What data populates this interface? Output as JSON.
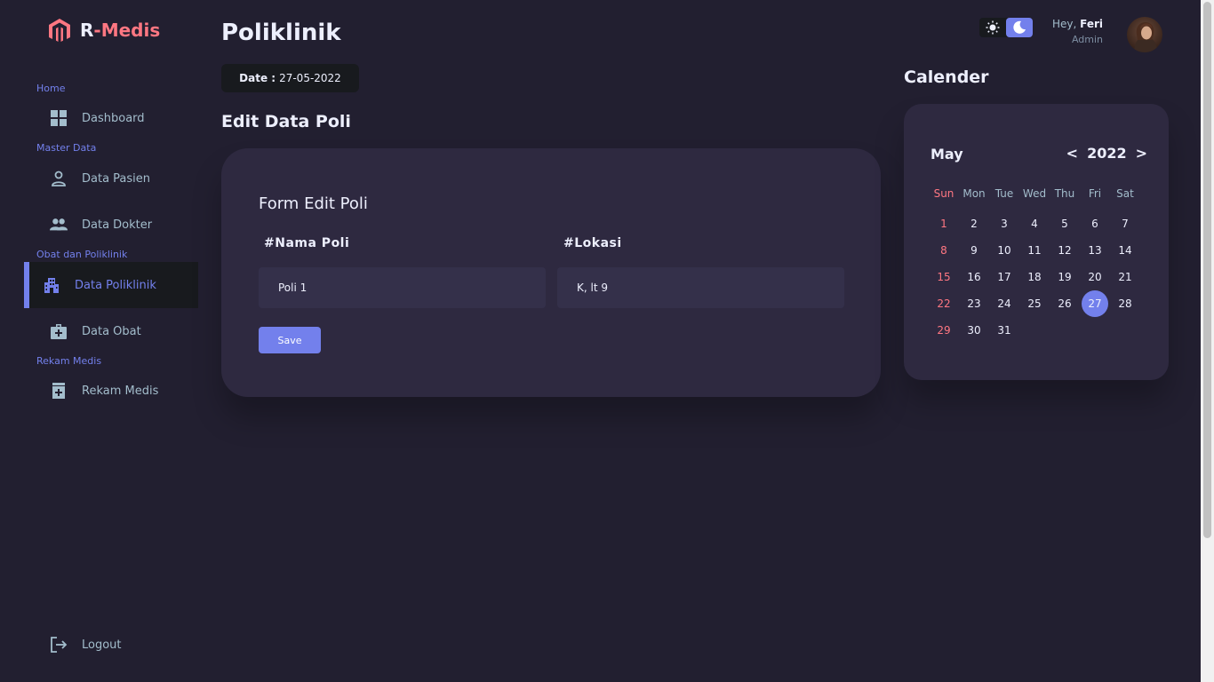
{
  "brand": {
    "prefix": "R",
    "suffix": "-Medis"
  },
  "sidebar": {
    "sections": {
      "home": "Home",
      "master": "Master Data",
      "obat_poli": "Obat dan Poliklinik",
      "rekam": "Rekam Medis"
    },
    "items": {
      "dashboard": {
        "label": "Dashboard",
        "icon": "dashboard-icon"
      },
      "pasien": {
        "label": "Data Pasien",
        "icon": "person-icon"
      },
      "dokter": {
        "label": "Data Dokter",
        "icon": "people-icon"
      },
      "poliklinik": {
        "label": "Data Poliklinik",
        "icon": "building-icon"
      },
      "obat": {
        "label": "Data Obat",
        "icon": "medical-kit-icon"
      },
      "rekam": {
        "label": "Rekam Medis",
        "icon": "medication-icon"
      },
      "logout": {
        "label": "Logout",
        "icon": "logout-icon"
      }
    }
  },
  "header": {
    "title": "Poliklinik",
    "date_label": "Date :",
    "date_value": "27-05-2022"
  },
  "main": {
    "section_title": "Edit Data Poli",
    "form": {
      "title": "Form Edit Poli",
      "nama_label": "#Nama Poli",
      "nama_value": "Poli 1",
      "lokasi_label": "#Lokasi",
      "lokasi_value": "K, lt 9",
      "save_label": "Save"
    }
  },
  "profile": {
    "greeting": "Hey,",
    "name": "Feri",
    "role": "Admin"
  },
  "theme": {
    "active": "dark"
  },
  "calendar": {
    "heading": "Calender",
    "month": "May",
    "year": "2022",
    "prev": "<",
    "next": ">",
    "days_of_week": [
      "Sun",
      "Mon",
      "Tue",
      "Wed",
      "Thu",
      "Fri",
      "Sat"
    ],
    "weeks": [
      [
        "1",
        "2",
        "3",
        "4",
        "5",
        "6",
        "7"
      ],
      [
        "8",
        "9",
        "10",
        "11",
        "12",
        "13",
        "14"
      ],
      [
        "15",
        "16",
        "17",
        "18",
        "19",
        "20",
        "21"
      ],
      [
        "22",
        "23",
        "24",
        "25",
        "26",
        "27",
        "28"
      ],
      [
        "29",
        "30",
        "31",
        "",
        "",
        "",
        ""
      ]
    ],
    "today": "27"
  },
  "colors": {
    "primary": "#7380ec",
    "danger": "#ff7782",
    "background": "#221f30",
    "card": "#2e2940",
    "dark": "#181a1e"
  }
}
